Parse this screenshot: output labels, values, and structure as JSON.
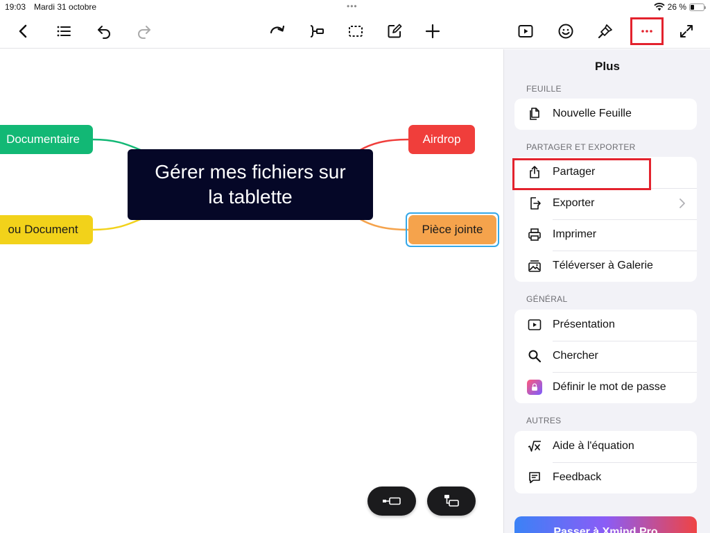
{
  "status": {
    "time": "19:03",
    "date": "Mardi 31 octobre",
    "multitask_dots": "•••",
    "battery": "26 %",
    "battery_level": 0.26
  },
  "toolbar": {
    "icons": [
      "back-chevron-icon",
      "outline-list-icon",
      "undo-icon",
      "redo-icon",
      "relationship-icon",
      "boundary-icon",
      "summary-icon",
      "note-icon",
      "add-icon",
      "play-icon",
      "emoji-icon",
      "format-brush-icon",
      "more-icon",
      "fullscreen-icon"
    ],
    "accent": "#e3222d"
  },
  "mindmap": {
    "central": {
      "line1": "Gérer mes fichiers sur",
      "line2": "la tablette",
      "color": "#050727"
    },
    "branches": [
      {
        "label": "Documentaire",
        "color": "#12b875"
      },
      {
        "label": "ou Document",
        "color": "#f2d21a"
      },
      {
        "label": "Airdrop",
        "color": "#f03e3b"
      },
      {
        "label": "Pièce jointe",
        "color": "#f5a34c",
        "selected": true
      }
    ],
    "floating_buttons": [
      "add-sibling-icon",
      "add-child-icon"
    ]
  },
  "panel": {
    "title": "Plus",
    "sections": [
      {
        "header": "FEUILLE",
        "items": [
          {
            "label": "Nouvelle Feuille",
            "icon": "new-sheet-icon"
          }
        ]
      },
      {
        "header": "PARTAGER ET EXPORTER",
        "items": [
          {
            "label": "Partager",
            "icon": "share-icon"
          },
          {
            "label": "Exporter",
            "icon": "export-icon",
            "chevron": true
          },
          {
            "label": "Imprimer",
            "icon": "printer-icon"
          },
          {
            "label": "Téléverser à Galerie",
            "icon": "gallery-icon"
          }
        ]
      },
      {
        "header": "GÉNÉRAL",
        "items": [
          {
            "label": "Présentation",
            "icon": "presentation-icon"
          },
          {
            "label": "Chercher",
            "icon": "search-icon"
          },
          {
            "label": "Définir le mot de passe",
            "icon": "lock-icon"
          }
        ]
      },
      {
        "header": "AUTRES",
        "items": [
          {
            "label": "Aide à l'équation",
            "icon": "equation-icon"
          },
          {
            "label": "Feedback",
            "icon": "feedback-icon"
          }
        ]
      }
    ],
    "pro_button": "Passer à Xmind Pro"
  }
}
